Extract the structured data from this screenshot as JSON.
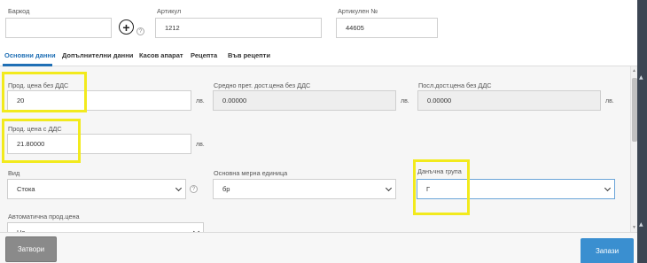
{
  "top_fields": {
    "barcode_label": "Баркод",
    "barcode_value": "",
    "article_label": "Артикул",
    "article_value": "1212",
    "article_no_label": "Артикулен №",
    "article_no_value": "44605",
    "add_symbol": "+",
    "help_symbol": "?"
  },
  "tabs": [
    {
      "label": "Основни данни",
      "active": true
    },
    {
      "label": "Допълнителни данни"
    },
    {
      "label": "Касов апарат"
    },
    {
      "label": "Рецепта"
    },
    {
      "label": "Във рецепти"
    }
  ],
  "form": {
    "sale_price_no_vat_label": "Прод. цена без ДДС",
    "sale_price_no_vat_value": "20",
    "avg_cost_label": "Средно прет. дост.цена без ДДС",
    "avg_cost_value": "0.00000",
    "last_cost_label": "Посл.дост.цена без ДДС",
    "last_cost_value": "0.00000",
    "sale_price_vat_label": "Прод. цена с ДДС",
    "sale_price_vat_value": "21.80000",
    "currency_unit": "лв.",
    "type_label": "Вид",
    "type_value": "Стока",
    "unit_label": "Основна мерна единица",
    "unit_value": "бр",
    "tax_group_label": "Данъчна група",
    "tax_group_value": "Г",
    "auto_price_label": "Автоматична прод.цена",
    "auto_price_value": "Не"
  },
  "footer": {
    "close_label": "Затвори",
    "save_label": "Запази"
  },
  "colors": {
    "accent": "#1f6fb5",
    "highlight": "#f2ea1d",
    "save_button": "#3a8fd0",
    "close_button": "#8a8a8a"
  }
}
